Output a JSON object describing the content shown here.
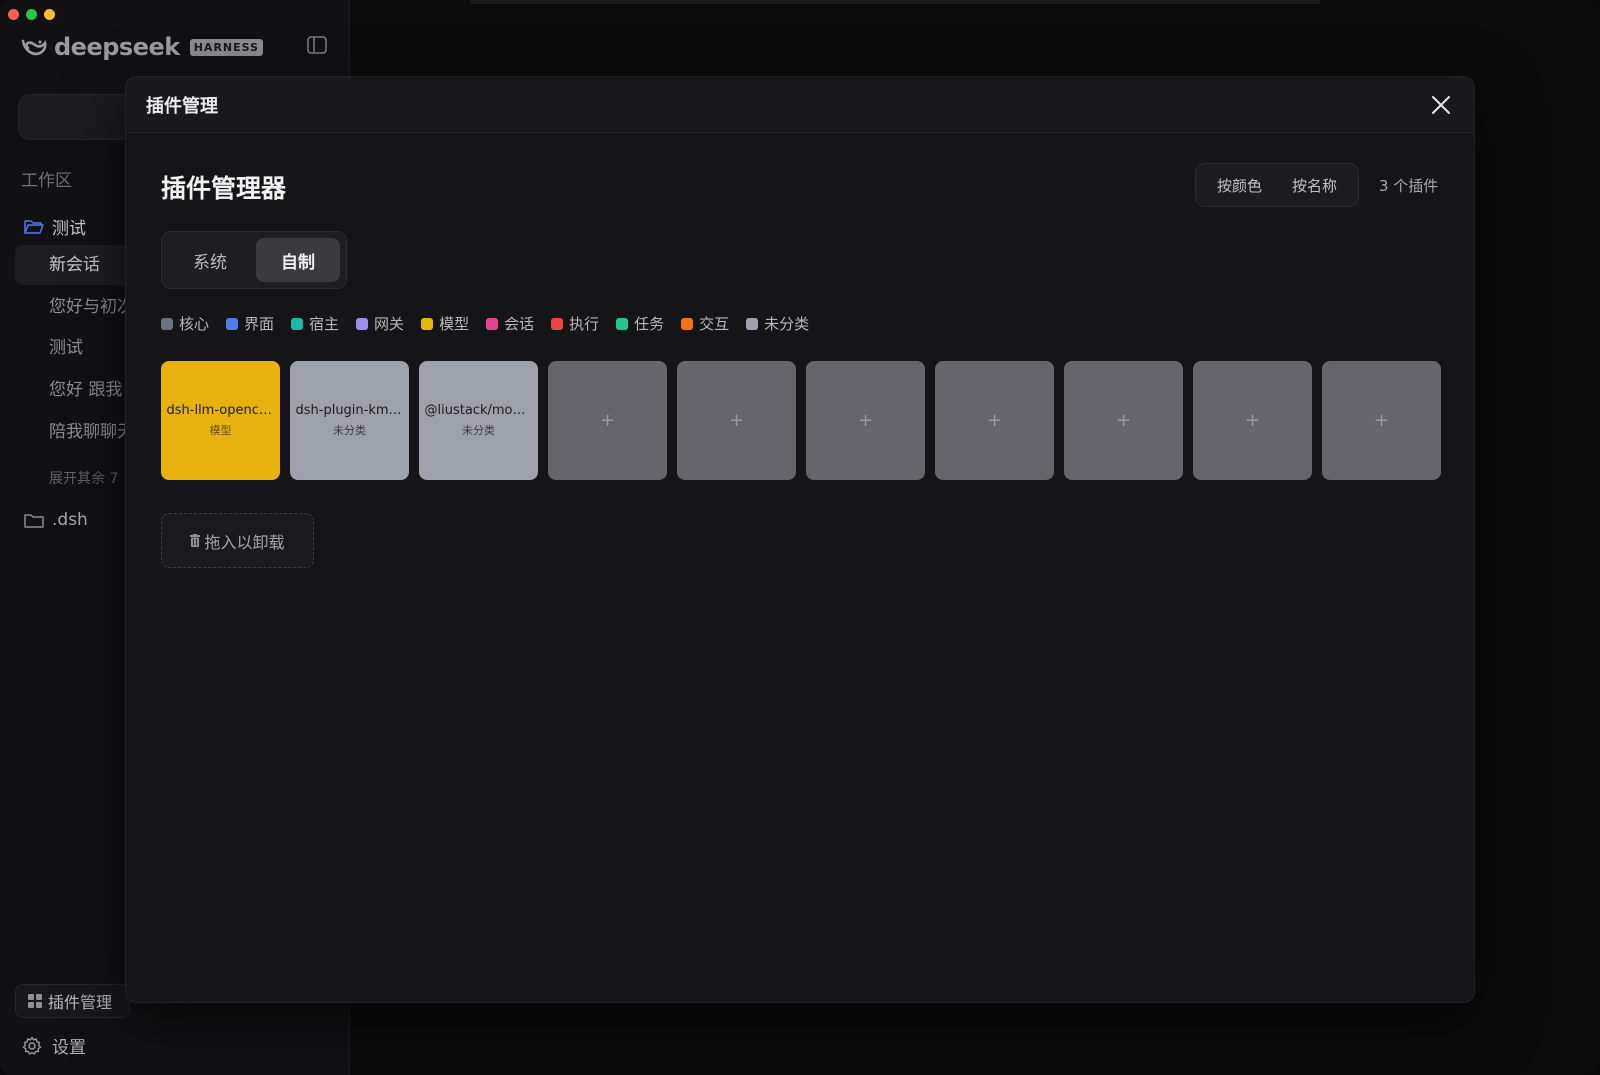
{
  "sidebar": {
    "brand_name": "deepseek",
    "brand_tag": "HARNESS",
    "section_label": "工作区",
    "workspace_folder": "测试",
    "sessions": [
      {
        "label": "新会话",
        "active": true
      },
      {
        "label": "您好与初次"
      },
      {
        "label": "测试"
      },
      {
        "label": "您好 跟我"
      },
      {
        "label": "陪我聊聊天"
      }
    ],
    "expand_more": "展开其余 7",
    "folder_dsh": ".dsh",
    "plugin_manager_label": "插件管理",
    "settings_label": "设置"
  },
  "modal": {
    "title": "插件管理",
    "manager_title": "插件管理器",
    "sort_by_color": "按颜色",
    "sort_by_name": "按名称",
    "plugin_count": "3 个插件",
    "tabs": [
      {
        "label": "系统",
        "active": false
      },
      {
        "label": "自制",
        "active": true
      }
    ],
    "legend": [
      {
        "label": "核心",
        "color": "#6b7280"
      },
      {
        "label": "界面",
        "color": "#4f7cf5"
      },
      {
        "label": "宿主",
        "color": "#1eb8a6"
      },
      {
        "label": "网关",
        "color": "#a08cf0"
      },
      {
        "label": "模型",
        "color": "#eab308"
      },
      {
        "label": "会话",
        "color": "#e84393"
      },
      {
        "label": "执行",
        "color": "#ef4444"
      },
      {
        "label": "任务",
        "color": "#22c58e"
      },
      {
        "label": "交互",
        "color": "#f97316"
      },
      {
        "label": "未分类",
        "color": "#9ca3af"
      }
    ],
    "plugins": [
      {
        "name": "dsh-llm-opencode",
        "category": "模型"
      },
      {
        "name": "dsh-plugin-kmux",
        "category": "未分类"
      },
      {
        "name": "@liustack/models",
        "category": "未分类"
      }
    ],
    "empty_slot": "+",
    "uninstall_label": "拖入以卸载",
    "uninstall_icon": "trash-icon"
  }
}
